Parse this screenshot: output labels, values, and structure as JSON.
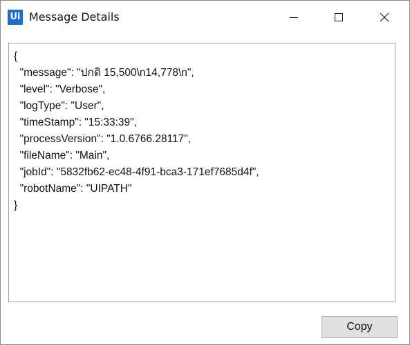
{
  "window": {
    "title": "Message Details",
    "app_icon_text": "Ui",
    "app_icon": "uipath-logo-icon",
    "minimize_icon": "minimize-icon",
    "maximize_icon": "maximize-icon",
    "close_icon": "close-icon"
  },
  "content": {
    "lines": [
      "{",
      "  \"message\": \"ปกติ 15,500\\n14,778\\n\",",
      "  \"level\": \"Verbose\",",
      "  \"logType\": \"User\",",
      "  \"timeStamp\": \"15:33:39\",",
      "  \"processVersion\": \"1.0.6766.28117\",",
      "  \"fileName\": \"Main\",",
      "  \"jobId\": \"5832fb62-ec48-4f91-bca3-171ef7685d4f\",",
      "  \"robotName\": \"UIPATH\"",
      "}"
    ]
  },
  "footer": {
    "copy_label": "Copy"
  },
  "colors": {
    "accent": "#1c6fc6",
    "button_face": "#e1e1e1",
    "border": "#a0a0a0"
  }
}
